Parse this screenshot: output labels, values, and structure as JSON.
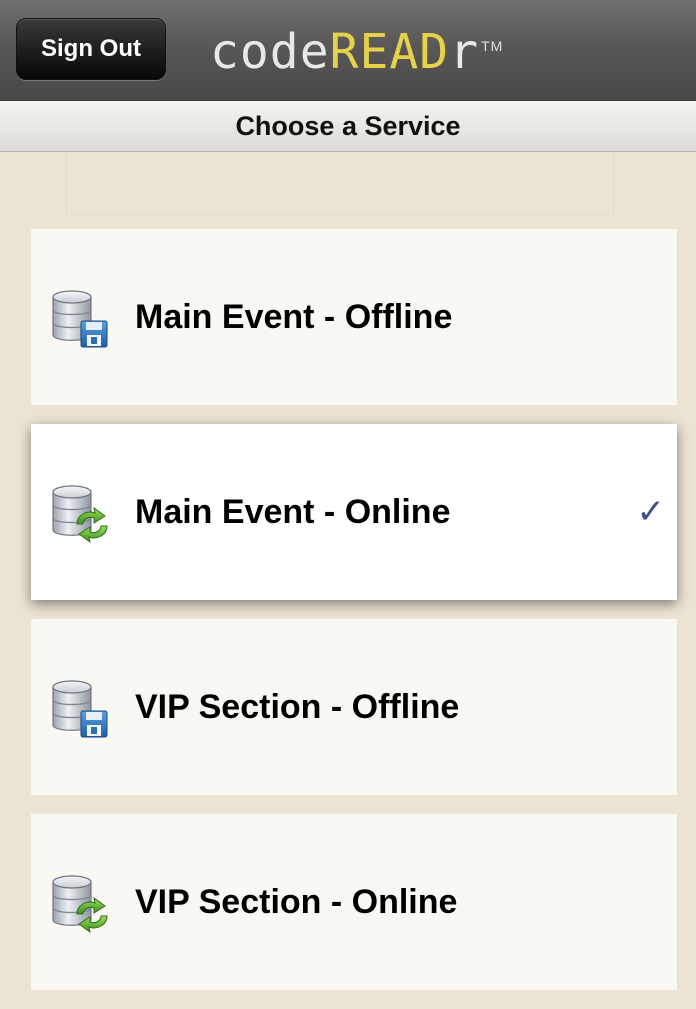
{
  "header": {
    "sign_out_label": "Sign Out",
    "logo": {
      "part_code": "code",
      "part_read": "READ",
      "part_r": "r",
      "trademark": "TM"
    }
  },
  "subheader": {
    "title": "Choose a Service"
  },
  "services": [
    {
      "label": "Main Event - Offline",
      "icon": "database-offline-save-icon",
      "selected": false
    },
    {
      "label": "Main Event - Online",
      "icon": "database-online-sync-icon",
      "selected": true
    },
    {
      "label": "VIP Section - Offline",
      "icon": "database-offline-save-icon",
      "selected": false
    },
    {
      "label": "VIP Section - Online",
      "icon": "database-online-sync-icon",
      "selected": false
    }
  ],
  "checkmark_glyph": "✓",
  "colors": {
    "background": "#ebe4d3",
    "logo_accent": "#e6d24a",
    "checkmark": "#3b5087",
    "offline_badge": "#2a6fb5",
    "online_badge": "#5aa832"
  }
}
